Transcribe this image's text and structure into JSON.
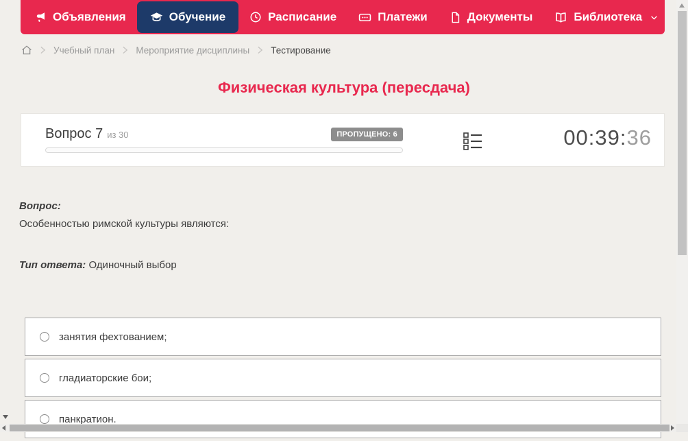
{
  "nav": {
    "items": [
      {
        "label": "Объявления",
        "icon": "megaphone-icon",
        "active": false
      },
      {
        "label": "Обучение",
        "icon": "graduation-cap-icon",
        "active": true
      },
      {
        "label": "Расписание",
        "icon": "clock-icon",
        "active": false
      },
      {
        "label": "Платежи",
        "icon": "wallet-icon",
        "active": false
      },
      {
        "label": "Документы",
        "icon": "document-icon",
        "active": false
      },
      {
        "label": "Библиотека",
        "icon": "book-icon",
        "active": false,
        "has_dropdown": true
      }
    ]
  },
  "breadcrumb": {
    "items": [
      "Учебный план",
      "Мероприятие дисциплины",
      "Тестирование"
    ]
  },
  "page": {
    "title": "Физическая культура (пересдача)"
  },
  "question_header": {
    "question_label": "Вопрос 7",
    "question_of": "из 30",
    "skipped_badge": "ПРОПУЩЕНО: 6",
    "timer_main": "00:39:",
    "timer_seconds": "36",
    "progress_percent": 0
  },
  "question": {
    "label": "Вопрос:",
    "text": "Особенностью римской культуры являются:",
    "answer_type_label": "Тип ответа:",
    "answer_type_value": "Одиночный выбор",
    "options": [
      {
        "label": "занятия фехтованием;",
        "selected": false
      },
      {
        "label": "гладиаторские бои;",
        "selected": false
      },
      {
        "label": "панкратион.",
        "selected": false
      }
    ]
  },
  "colors": {
    "accent": "#e8284e",
    "active_tab": "#1d3a69",
    "badge_bg": "#8d8d8d",
    "page_bg": "#f1efeb"
  }
}
